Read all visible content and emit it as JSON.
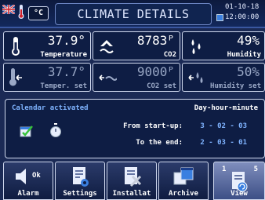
{
  "header": {
    "unit": "°C",
    "title": "CLIMATE DETAILS",
    "date": "01-10-18",
    "time": "12:00:00"
  },
  "tiles": {
    "temperature": {
      "value": "37.9°",
      "label": "Temperature"
    },
    "co2": {
      "value": "8783ᴾ",
      "label": "CO2"
    },
    "humidity": {
      "value": "49%",
      "label": "Humidity"
    },
    "temper_set": {
      "value": "37.7°",
      "label": "Temper. set"
    },
    "co2_set": {
      "value": "9000ᴾ",
      "label": "CO2 set"
    },
    "humidity_set": {
      "value": "50%",
      "label": "Humidity set"
    }
  },
  "calendar": {
    "status": "Calendar activated",
    "format": "Day-hour-minute",
    "from_label": "From start-up:",
    "from_value": "3 - 02 - 03",
    "end_label": "To the end:",
    "end_value": "2 - 03 - 01"
  },
  "buttons": {
    "alarm": "Alarm",
    "alarm_badge": "Ok",
    "settings": "Settings",
    "installat": "Installat",
    "archive": "Archive",
    "view": "View",
    "page_current": "1",
    "page_total": "5"
  },
  "colors": {
    "background": "#1b2a55",
    "accent": "#7fb3ff",
    "border": "#cfd8ee"
  }
}
